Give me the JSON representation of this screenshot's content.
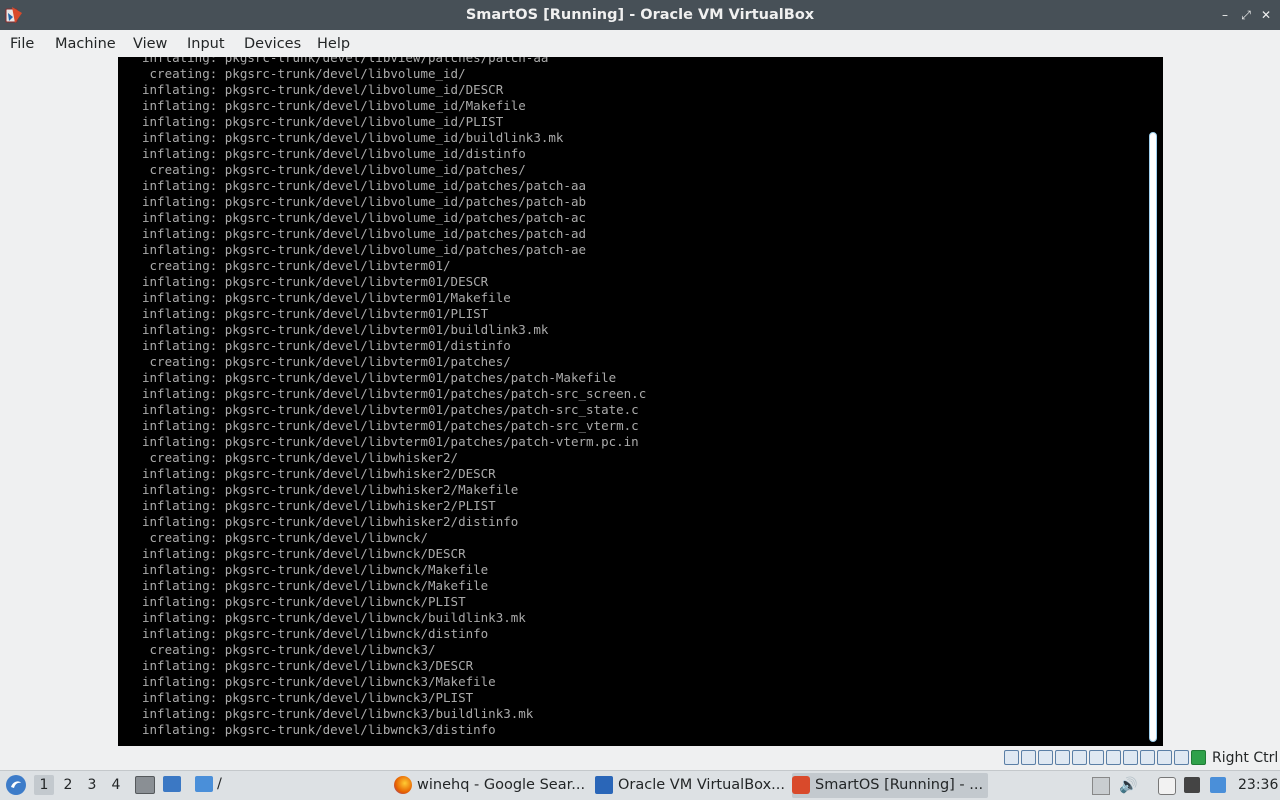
{
  "window": {
    "title": "SmartOS [Running] - Oracle VM VirtualBox",
    "controls": {
      "minimize": "–",
      "restore": "⤢",
      "close": "✕"
    }
  },
  "menubar": {
    "items": [
      "File",
      "Machine",
      "View",
      "Input",
      "Devices",
      "Help"
    ]
  },
  "console": {
    "lines": [
      "inflating: pkgsrc-trunk/devel/libview/patches/patch-aa",
      " creating: pkgsrc-trunk/devel/libvolume_id/",
      "inflating: pkgsrc-trunk/devel/libvolume_id/DESCR",
      "inflating: pkgsrc-trunk/devel/libvolume_id/Makefile",
      "inflating: pkgsrc-trunk/devel/libvolume_id/PLIST",
      "inflating: pkgsrc-trunk/devel/libvolume_id/buildlink3.mk",
      "inflating: pkgsrc-trunk/devel/libvolume_id/distinfo",
      " creating: pkgsrc-trunk/devel/libvolume_id/patches/",
      "inflating: pkgsrc-trunk/devel/libvolume_id/patches/patch-aa",
      "inflating: pkgsrc-trunk/devel/libvolume_id/patches/patch-ab",
      "inflating: pkgsrc-trunk/devel/libvolume_id/patches/patch-ac",
      "inflating: pkgsrc-trunk/devel/libvolume_id/patches/patch-ad",
      "inflating: pkgsrc-trunk/devel/libvolume_id/patches/patch-ae",
      " creating: pkgsrc-trunk/devel/libvterm01/",
      "inflating: pkgsrc-trunk/devel/libvterm01/DESCR",
      "inflating: pkgsrc-trunk/devel/libvterm01/Makefile",
      "inflating: pkgsrc-trunk/devel/libvterm01/PLIST",
      "inflating: pkgsrc-trunk/devel/libvterm01/buildlink3.mk",
      "inflating: pkgsrc-trunk/devel/libvterm01/distinfo",
      " creating: pkgsrc-trunk/devel/libvterm01/patches/",
      "inflating: pkgsrc-trunk/devel/libvterm01/patches/patch-Makefile",
      "inflating: pkgsrc-trunk/devel/libvterm01/patches/patch-src_screen.c",
      "inflating: pkgsrc-trunk/devel/libvterm01/patches/patch-src_state.c",
      "inflating: pkgsrc-trunk/devel/libvterm01/patches/patch-src_vterm.c",
      "inflating: pkgsrc-trunk/devel/libvterm01/patches/patch-vterm.pc.in",
      " creating: pkgsrc-trunk/devel/libwhisker2/",
      "inflating: pkgsrc-trunk/devel/libwhisker2/DESCR",
      "inflating: pkgsrc-trunk/devel/libwhisker2/Makefile",
      "inflating: pkgsrc-trunk/devel/libwhisker2/PLIST",
      "inflating: pkgsrc-trunk/devel/libwhisker2/distinfo",
      " creating: pkgsrc-trunk/devel/libwnck/",
      "inflating: pkgsrc-trunk/devel/libwnck/DESCR",
      "inflating: pkgsrc-trunk/devel/libwnck/Makefile",
      "inflating: pkgsrc-trunk/devel/libwnck/Makefile",
      "inflating: pkgsrc-trunk/devel/libwnck/PLIST",
      "inflating: pkgsrc-trunk/devel/libwnck/buildlink3.mk",
      "inflating: pkgsrc-trunk/devel/libwnck/distinfo",
      " creating: pkgsrc-trunk/devel/libwnck3/",
      "inflating: pkgsrc-trunk/devel/libwnck3/DESCR",
      "inflating: pkgsrc-trunk/devel/libwnck3/Makefile",
      "inflating: pkgsrc-trunk/devel/libwnck3/PLIST",
      "inflating: pkgsrc-trunk/devel/libwnck3/buildlink3.mk",
      "inflating: pkgsrc-trunk/devel/libwnck3/distinfo"
    ]
  },
  "statusbar": {
    "host_key": "Right Ctrl",
    "icons": [
      "hard-disk-icon",
      "optical-drive-icon",
      "audio-icon",
      "network-icon",
      "usb-icon",
      "shared-folders-icon",
      "display-icon",
      "video-capture-icon",
      "keyboard-capture-icon",
      "mouse-integration-icon",
      "cpu-activity-icon",
      "arrow-down-icon"
    ]
  },
  "taskbar": {
    "desktops": [
      "1",
      "2",
      "3",
      "4"
    ],
    "active_desktop": "1",
    "quick_launch_label": "/",
    "tasks": [
      {
        "label": "winehq - Google Sear...",
        "icon": "firefox-icon"
      },
      {
        "label": "Oracle VM VirtualBox...",
        "icon": "virtualbox-manager-icon"
      },
      {
        "label": "SmartOS [Running] - ...",
        "icon": "virtualbox-vm-icon"
      }
    ],
    "clock": "23:36"
  },
  "colors": {
    "titlebar_bg": "#475057",
    "console_bg": "#000000",
    "console_text": "#aaaaaa",
    "panel_bg": "#eff0f1"
  }
}
